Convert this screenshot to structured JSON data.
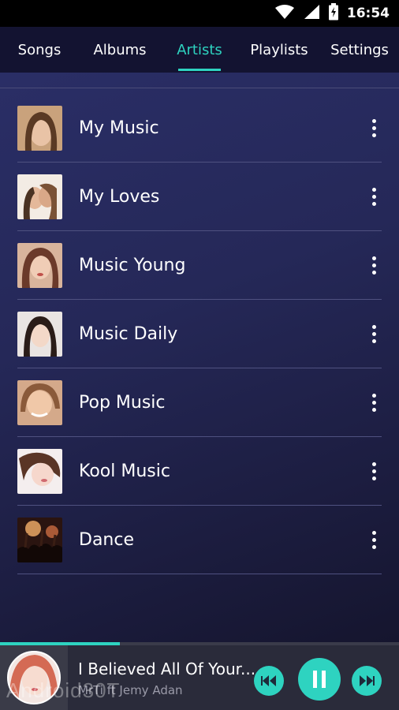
{
  "status_bar": {
    "time": "16:54",
    "icons": [
      "wifi-icon",
      "cell-signal-icon",
      "battery-charging-icon"
    ]
  },
  "tabs": [
    {
      "label": "Songs",
      "active": false
    },
    {
      "label": "Albums",
      "active": false
    },
    {
      "label": "Artists",
      "active": true
    },
    {
      "label": "Playlists",
      "active": false
    },
    {
      "label": "Settings",
      "active": false
    }
  ],
  "artists": [
    {
      "name": "My Music"
    },
    {
      "name": "My Loves"
    },
    {
      "name": "Music Young"
    },
    {
      "name": "Music Daily"
    },
    {
      "name": "Pop Music"
    },
    {
      "name": "Kool Music"
    },
    {
      "name": "Dance"
    }
  ],
  "now_playing": {
    "title": "I Believed All Of Your...",
    "artist": "MrTi ft Jemy Adan",
    "progress": 0.3
  },
  "watermark": "Android30T",
  "colors": {
    "accent": "#2ed3c0",
    "tab_bar": "#131331",
    "player_bg": "#2a2b3a"
  }
}
